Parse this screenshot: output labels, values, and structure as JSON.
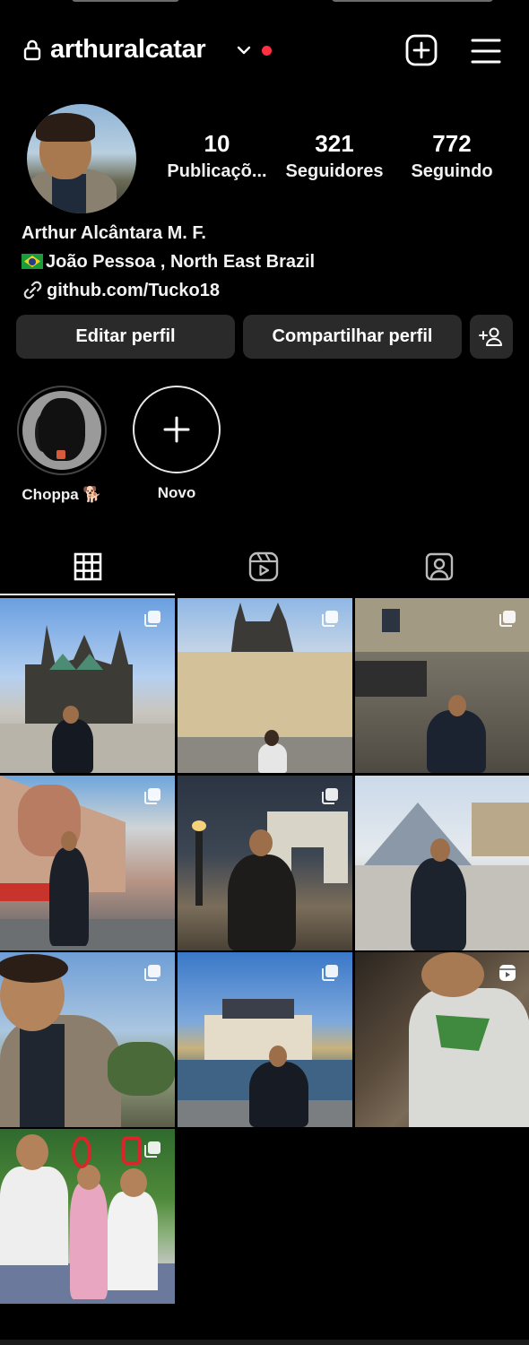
{
  "header": {
    "username": "arthuralcatar",
    "has_notification_dot": true,
    "notification_dot_color": "#ff3040"
  },
  "stats": {
    "posts": {
      "value": "10",
      "label": "Publicaçõ..."
    },
    "followers": {
      "value": "321",
      "label": "Seguidores"
    },
    "following": {
      "value": "772",
      "label": "Seguindo"
    }
  },
  "bio": {
    "name": "Arthur Alcântara M. F.",
    "location": "João Pessoa , North East Brazil",
    "link": "github.com/Tucko18"
  },
  "actions": {
    "edit_profile": "Editar perfil",
    "share_profile": "Compartilhar perfil"
  },
  "highlights": [
    {
      "label": "Choppa 🐕"
    },
    {
      "label": "Novo"
    }
  ],
  "tabs": [
    {
      "icon": "grid-icon",
      "active": true
    },
    {
      "icon": "reels-icon",
      "active": false
    },
    {
      "icon": "tagged-icon",
      "active": false
    }
  ],
  "posts": [
    {
      "scene": "cathedral",
      "type": "carousel"
    },
    {
      "scene": "old-town-square",
      "type": "carousel"
    },
    {
      "scene": "stone-building",
      "type": "carousel"
    },
    {
      "scene": "berlin-wall-mural",
      "type": "carousel"
    },
    {
      "scene": "arc-de-triomphe-night",
      "type": "carousel"
    },
    {
      "scene": "louvre-pyramid",
      "type": "carousel"
    },
    {
      "scene": "portrait-viewpoint",
      "type": "carousel"
    },
    {
      "scene": "canal-building",
      "type": "carousel"
    },
    {
      "scene": "indoor-shirt",
      "type": "reel"
    },
    {
      "scene": "kids-birthday",
      "type": "carousel"
    }
  ],
  "colors": {
    "background": "#000000",
    "button": "#2a2a2a",
    "text": "#f5f5f5"
  }
}
